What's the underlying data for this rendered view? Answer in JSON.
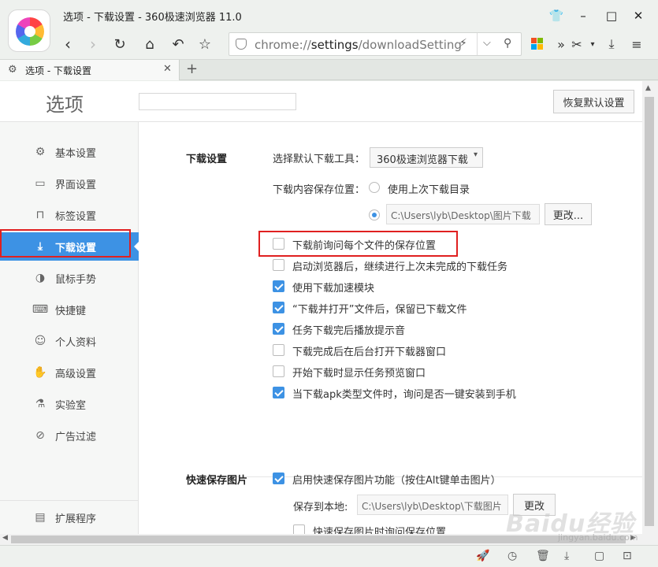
{
  "window": {
    "title": "选项 - 下载设置 - 360极速浏览器 11.0"
  },
  "address": {
    "scheme": "chrome://",
    "host": "settings",
    "path": "/downloadSetting"
  },
  "tab": {
    "label": "选项 - 下载设置",
    "new_tab": "+"
  },
  "header": {
    "title": "选项",
    "search_placeholder": "",
    "reset_label": "恢复默认设置"
  },
  "sidebar": {
    "items": [
      {
        "label": "基本设置",
        "icon": "gear-icon",
        "glyph": "⚙"
      },
      {
        "label": "界面设置",
        "icon": "window-icon",
        "glyph": "▭"
      },
      {
        "label": "标签设置",
        "icon": "tab-icon",
        "glyph": "⊓"
      },
      {
        "label": "下载设置",
        "icon": "download-icon",
        "glyph": "⤓"
      },
      {
        "label": "鼠标手势",
        "icon": "mouse-icon",
        "glyph": "◑"
      },
      {
        "label": "快捷键",
        "icon": "keyboard-icon",
        "glyph": "⌨"
      },
      {
        "label": "个人资料",
        "icon": "user-icon",
        "glyph": "☺"
      },
      {
        "label": "高级设置",
        "icon": "hand-icon",
        "glyph": "✋"
      },
      {
        "label": "实验室",
        "icon": "flask-icon",
        "glyph": "⚗"
      },
      {
        "label": "广告过滤",
        "icon": "block-icon",
        "glyph": "⊘"
      }
    ],
    "footer": {
      "label": "扩展程序",
      "icon": "extension-icon",
      "glyph": "▤"
    }
  },
  "download": {
    "section_title": "下载设置",
    "tool_label": "选择默认下载工具：",
    "tool_value": "360极速浏览器下载",
    "location_label": "下载内容保存位置：",
    "radio_last": "使用上次下载目录",
    "path": "C:\\Users\\lyb\\Desktop\\图片下载",
    "change_label": "更改...",
    "options": [
      {
        "label": "下载前询问每个文件的保存位置",
        "checked": false
      },
      {
        "label": "启动浏览器后，继续进行上次未完成的下载任务",
        "checked": false
      },
      {
        "label": "使用下载加速模块",
        "checked": true
      },
      {
        "label": "“下载并打开”文件后，保留已下载文件",
        "checked": true
      },
      {
        "label": "任务下载完后播放提示音",
        "checked": true
      },
      {
        "label": "下载完成后在后台打开下载器窗口",
        "checked": false
      },
      {
        "label": "开始下载时显示任务预览窗口",
        "checked": false
      },
      {
        "label": "当下载apk类型文件时，询问是否一键安装到手机",
        "checked": true
      }
    ]
  },
  "quicksave": {
    "section_title": "快速保存图片",
    "enable_label": "启用快速保存图片功能（按住Alt键单击图片）",
    "enable_checked": true,
    "save_to_label": "保存到本地:",
    "path": "C:\\Users\\lyb\\Desktop\\下载图片",
    "change_label": "更改",
    "ask_label": "快速保存图片时询问保存位置",
    "ask_checked": false
  },
  "watermark": {
    "text": "Baidu经验",
    "url": "jingyan.baidu.com"
  },
  "colors": {
    "accent": "#3d92e4",
    "highlight_box": "#e02020"
  }
}
